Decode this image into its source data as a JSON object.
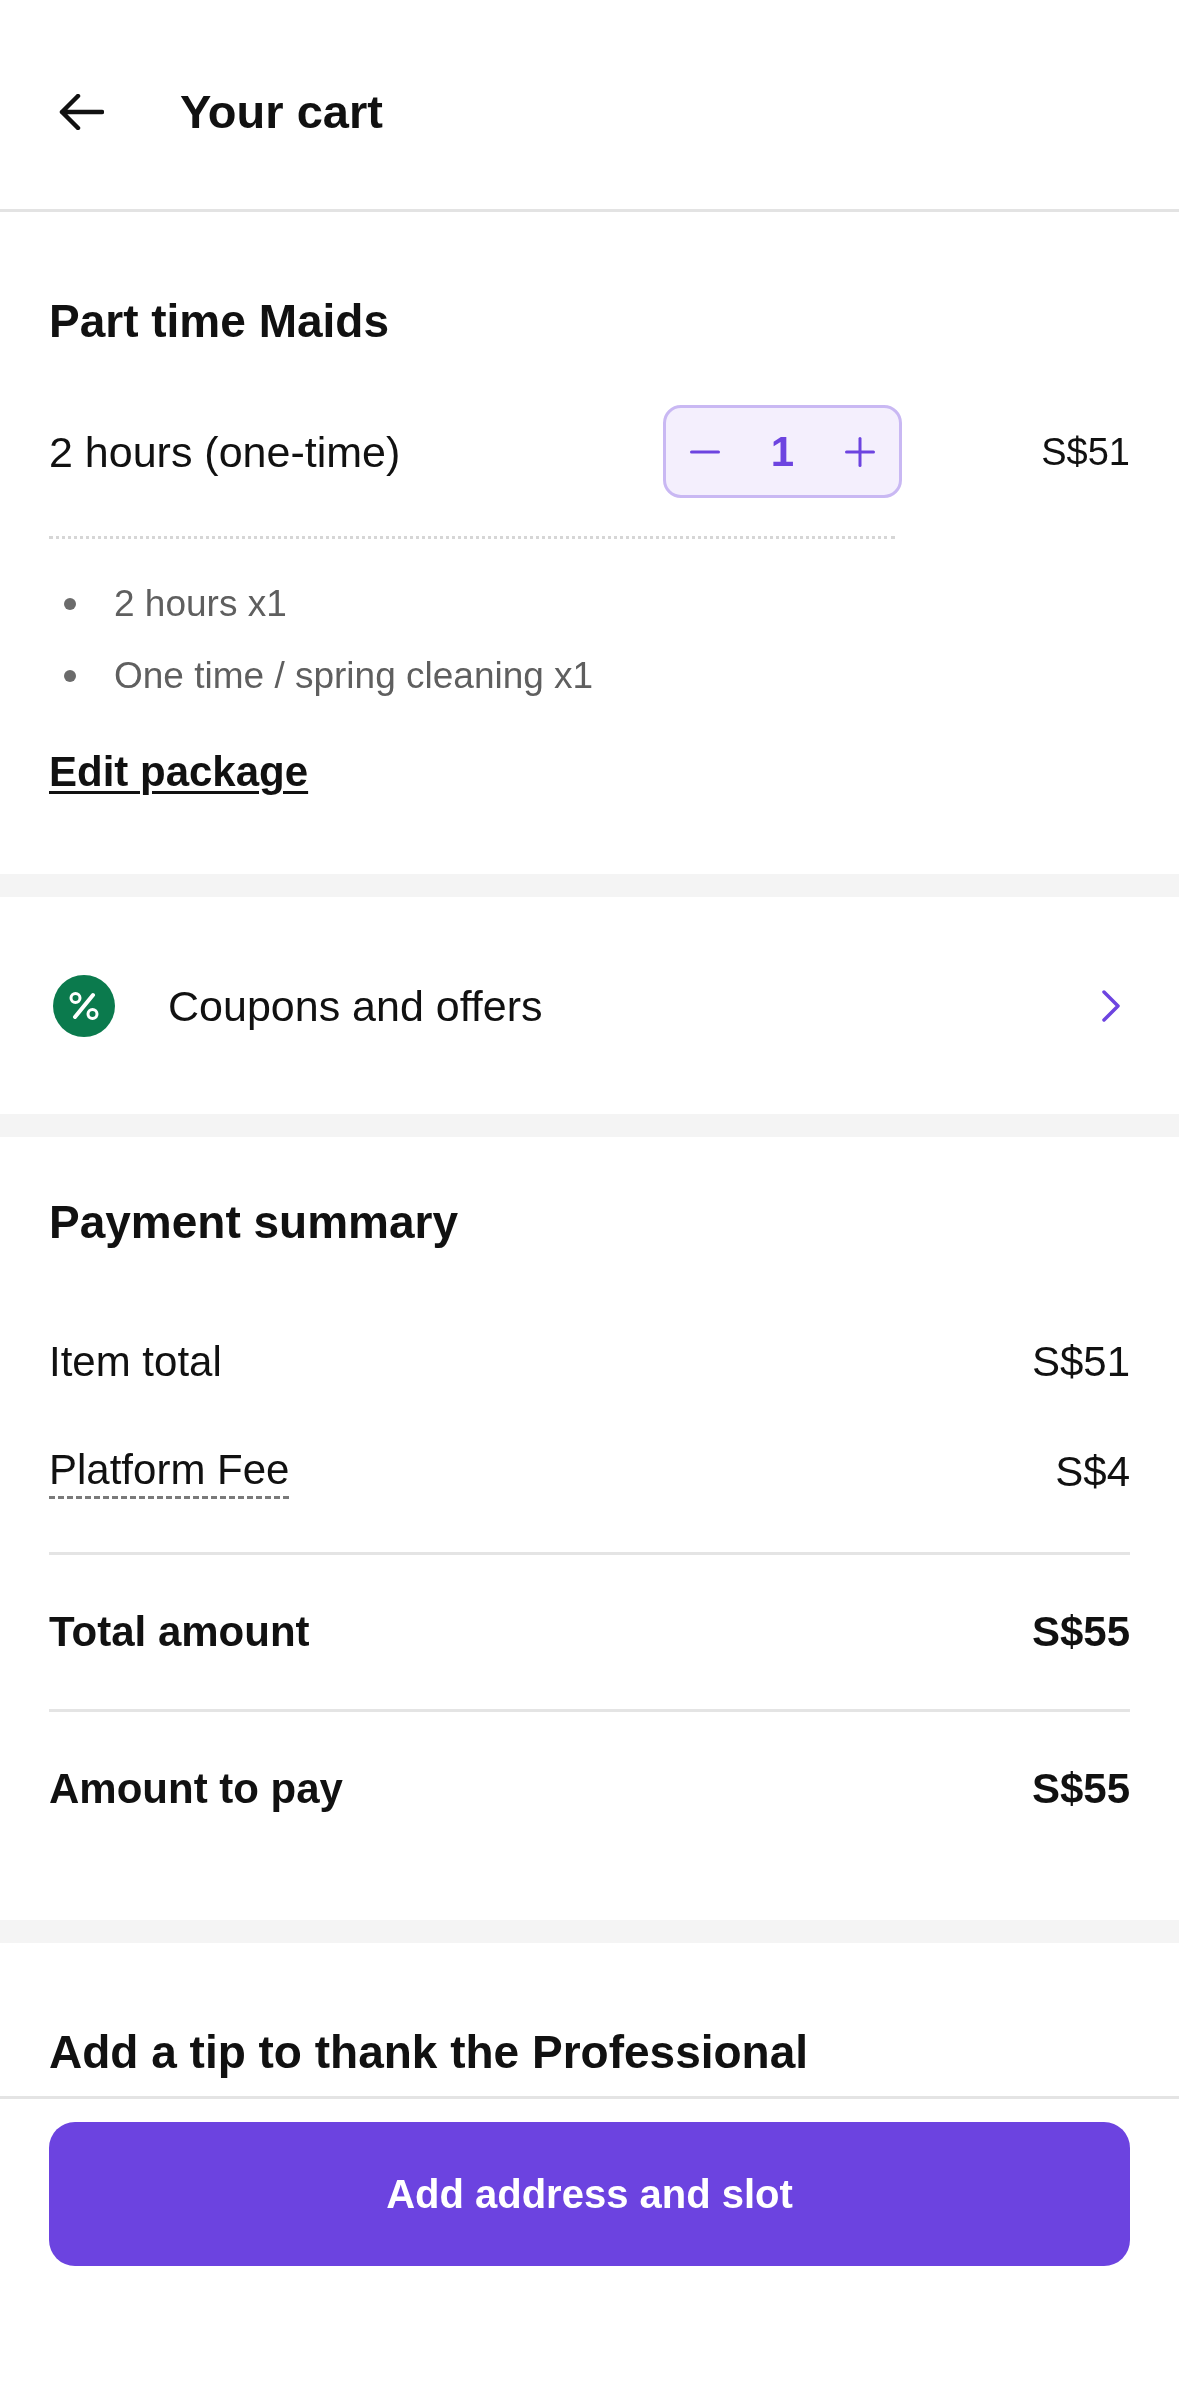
{
  "header": {
    "title": "Your cart"
  },
  "cart": {
    "title": "Part time Maids",
    "item": {
      "name": "2 hours (one-time)",
      "quantity": "1",
      "price": "S$51"
    },
    "details": [
      "2 hours x1",
      "One time / spring cleaning x1"
    ],
    "edit_link": "Edit package"
  },
  "coupons": {
    "label": "Coupons and offers"
  },
  "payment_summary": {
    "title": "Payment summary",
    "rows": [
      {
        "kind": "plain",
        "label": "Item total",
        "value": "S$51"
      },
      {
        "kind": "info",
        "label": "Platform Fee",
        "value": "S$4"
      },
      {
        "kind": "total",
        "label": "Total amount",
        "value": "S$55"
      },
      {
        "kind": "total",
        "label": "Amount to pay",
        "value": "S$55"
      }
    ]
  },
  "tip": {
    "title": "Add a tip to thank the Professional"
  },
  "cta": {
    "label": "Add address and slot"
  }
}
